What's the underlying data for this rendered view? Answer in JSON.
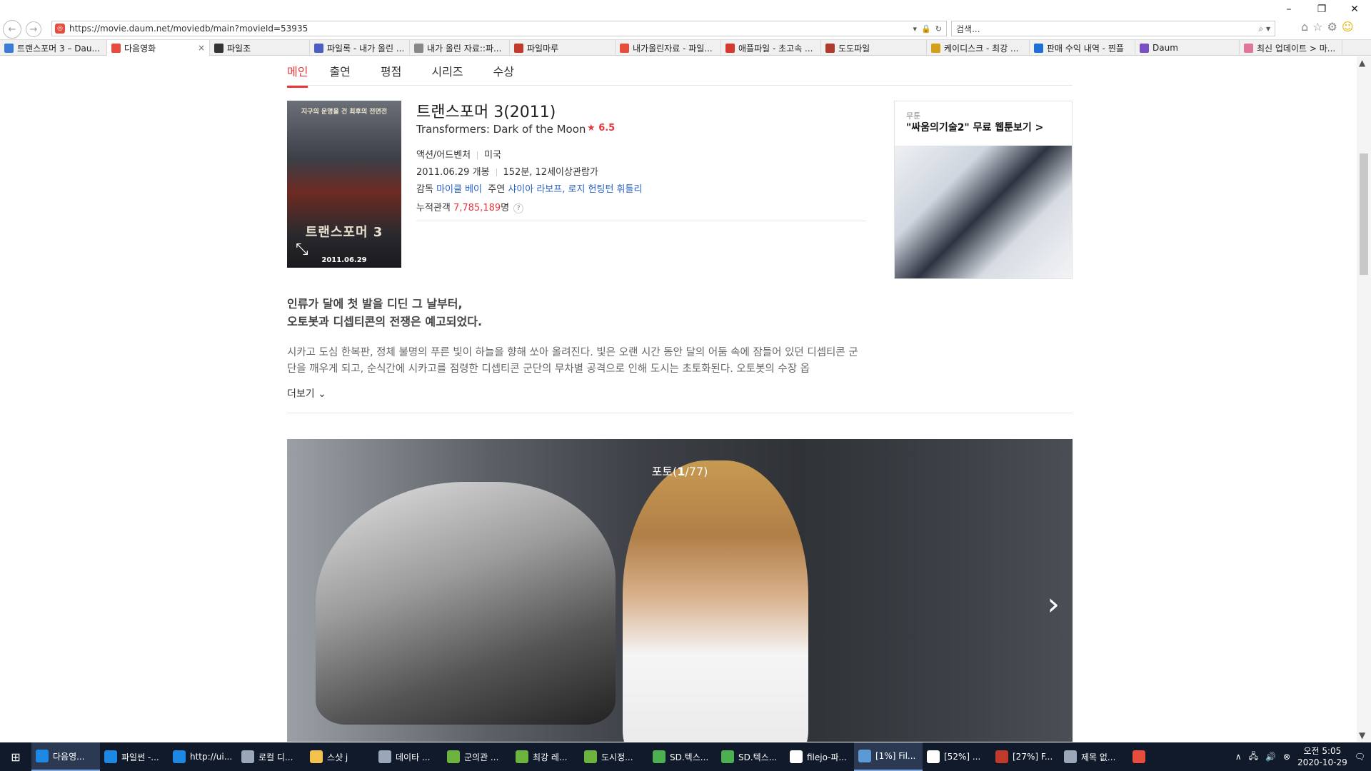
{
  "browser": {
    "url": "https://movie.daum.net/moviedb/main?movieId=53935",
    "search_placeholder": "검색...",
    "win_min": "–",
    "win_max": "❐",
    "win_close": "✕",
    "tabs": [
      {
        "label": "트랜스포머 3 – Dau...",
        "color": "#3b7bd8",
        "active": false
      },
      {
        "label": "다음영화",
        "color": "#e84c3d",
        "active": true,
        "close": "×"
      },
      {
        "label": "파일조",
        "color": "#333333",
        "active": false
      },
      {
        "label": "파일록 - 내가 올린 ...",
        "color": "#4a5fc1",
        "active": false
      },
      {
        "label": "내가 올린 자료::파...",
        "color": "#888888",
        "active": false
      },
      {
        "label": "파일마루",
        "color": "#c0392b",
        "active": false
      },
      {
        "label": "내가올린자료 - 파일...",
        "color": "#e74c3c",
        "active": false
      },
      {
        "label": "애플파일 - 초고속 ...",
        "color": "#d63a2f",
        "active": false
      },
      {
        "label": "도도파일",
        "color": "#b03a2e",
        "active": false
      },
      {
        "label": "케이디스크 - 최강 ...",
        "color": "#d4a017",
        "active": false
      },
      {
        "label": "판매 수익 내역 - 찐플",
        "color": "#1e6fd8",
        "active": false
      },
      {
        "label": "Daum",
        "color": "#7a4fc4",
        "active": false
      },
      {
        "label": "최신 업데이트 > 마...",
        "color": "#e0779b",
        "active": false
      }
    ]
  },
  "movie": {
    "menu": [
      "메인",
      "출연",
      "평점",
      "시리즈",
      "수상"
    ],
    "poster_top_text": "지구의 운명을 건 최후의 전면전",
    "poster_title": "트랜스포머 3",
    "poster_date": "2011.06.29",
    "title": "트랜스포머 3(2011)",
    "english_title": "Transformers: Dark of the Moon",
    "rating": "6.5",
    "genre": "액션/어드벤처",
    "country": "미국",
    "release": "2011.06.29 개봉",
    "runtime_rating": "152분, 12세이상관람가",
    "director_label": "감독",
    "director": "마이클 베이",
    "cast_label": "주연",
    "cast": "샤이아 라보프, 로지 헌팅턴 휘틀리",
    "audience_label": "누적관객",
    "audience": "7,785,189",
    "audience_unit": "명",
    "tagline_1": "인류가 달에 첫 발을 디딘 그 날부터,",
    "tagline_2": "오토봇과 디셉티콘의 전쟁은 예고되었다.",
    "synopsis": "시카고 도심 한복판, 정체 불명의 푸른 빛이 하늘을 향해 쏘아 올려진다. 빛은 오랜 시간 동안 달의 어둠 속에 잠들어 있던 디셉티콘 군단을 깨우게 되고, 순식간에 시카고를 점령한 디셉티콘 군단의 무차별 공격으로 인해 도시는 초토화된다. 오토봇의 수장 옵",
    "more": "더보기",
    "photo_counter_prefix": "포토(",
    "photo_current": "1",
    "photo_total": "/77)"
  },
  "ad": {
    "label": "무툰",
    "headline": "\"싸움의기술2\" 무료 웹툰보기 >"
  },
  "taskbar": {
    "items": [
      {
        "label": "다음영...",
        "color": "#1e88e5",
        "active": true
      },
      {
        "label": "파일썬 -...",
        "color": "#1e88e5",
        "active": false
      },
      {
        "label": "http://ui...",
        "color": "#1e88e5",
        "active": false
      },
      {
        "label": "로컬 디...",
        "color": "#9aa7b8",
        "active": false
      },
      {
        "label": "스샷 j",
        "color": "#f2c14e",
        "active": false
      },
      {
        "label": "데이타 ...",
        "color": "#9aa7b8",
        "active": false
      },
      {
        "label": "군의관 ...",
        "color": "#6db33f",
        "active": false
      },
      {
        "label": "최강 레...",
        "color": "#6db33f",
        "active": false
      },
      {
        "label": "도시정...",
        "color": "#6db33f",
        "active": false
      },
      {
        "label": "SD.텍스...",
        "color": "#4caf50",
        "active": false
      },
      {
        "label": "SD.텍스...",
        "color": "#4caf50",
        "active": false
      },
      {
        "label": "filejo-파...",
        "color": "#ffffff",
        "active": false
      },
      {
        "label": "[1%] Fil...",
        "color": "#5c9ad6",
        "active": true
      },
      {
        "label": "[52%] ...",
        "color": "#ffffff",
        "active": false
      },
      {
        "label": "[27%] F...",
        "color": "#c0392b",
        "active": false
      },
      {
        "label": "제목 없...",
        "color": "#9aa7b8",
        "active": false
      },
      {
        "label": "",
        "color": "#e74c3c",
        "active": false
      }
    ],
    "time": "오전 5:05",
    "date": "2020-10-29"
  }
}
